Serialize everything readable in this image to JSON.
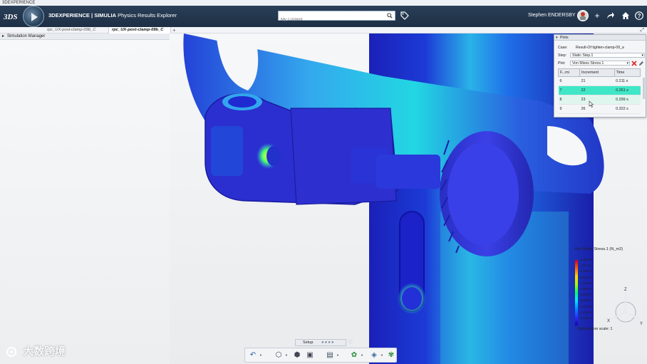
{
  "os": {
    "title": "3DEXPERIENCE"
  },
  "app": {
    "title_brand": "3DEXPERIENCE | SIMULIA",
    "title_app": " Physics Results Explorer",
    "search": {
      "placeholder": "My Content"
    },
    "user": "Stephen ENDERSBY"
  },
  "tabs": [
    {
      "label": "rpc_UX-post-clamp-09b_C",
      "active": false
    },
    {
      "label": "rpc_UX-post-clamp-09b_C",
      "active": true
    }
  ],
  "left_panel": {
    "title": "Simulation Manager"
  },
  "plots_panel": {
    "title": "Plots",
    "case_label": "Case:",
    "case_value": "Result-Of tighten-clamp-09_a",
    "step_label": "Step:",
    "step_value": "Static Step.1",
    "plot_label": "Plot:",
    "plot_value": "Von Mises Stress.1",
    "table": {
      "headers": [
        "F...mi",
        "Increment",
        "Time"
      ],
      "rows": [
        {
          "frame": "6",
          "increment": "21",
          "time": "0.211 s"
        },
        {
          "frame": "7",
          "increment": "22",
          "time": "0.261 s",
          "selected": true
        },
        {
          "frame": "8",
          "increment": "23",
          "time": "0.299 s",
          "hover": true
        },
        {
          "frame": "9",
          "increment": "26",
          "time": "0.322 s"
        }
      ]
    }
  },
  "legend": {
    "title": "Von Mises Stress.1 (N_m2)",
    "values": [
      "1.22e+8",
      "1.1e+8",
      "9.75e+7",
      "8.53e+7",
      "7.31e+7",
      "6.09e+7",
      "4.87e+7",
      "3.66e+7",
      "2.44e+7",
      "1.22e+7",
      "1.23e+4"
    ],
    "deformation": "Deformation scale: 1"
  },
  "triad": {
    "x": "X",
    "y": "Y",
    "z": "Z"
  },
  "setup": {
    "label": "Setup"
  },
  "watermark": "大数跨境",
  "colors": {
    "accent": "#3fe7c6",
    "topbar": "#1d2f44"
  }
}
